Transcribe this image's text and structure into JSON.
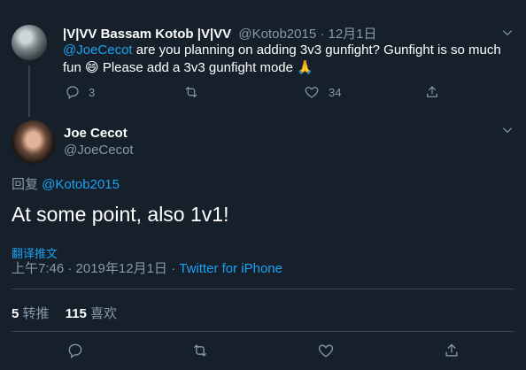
{
  "parent": {
    "name": "|V|VV Bassam Kotob |V|VV",
    "handle": "@Kotob2015",
    "dot": "·",
    "date": "12月1日",
    "mention": "@JoeCecot",
    "text_rest": " are you planning on adding 3v3 gunfight? Gunfight is so much fun 😄 Please add a 3v3 gunfight mode 🙏",
    "replies": "3",
    "likes": "34"
  },
  "main": {
    "name": "Joe Cecot",
    "handle": "@JoeCecot",
    "replying_label": "回复 ",
    "replying_handle": "@Kotob2015",
    "text": "At some point, also 1v1!",
    "translate": "翻译推文",
    "time": "上午7:46 · 2019年12月1日 · ",
    "source": "Twitter for iPhone",
    "retweets_count": "5",
    "retweets_label": " 转推",
    "likes_count": "115",
    "likes_label": " 喜欢"
  },
  "colors": {
    "background": "#15202b",
    "accent": "#1da1f2",
    "muted": "#8899a6",
    "divider": "#38444d"
  },
  "icons": [
    "chevron-down-icon",
    "reply-icon",
    "retweet-icon",
    "like-icon",
    "share-icon"
  ]
}
